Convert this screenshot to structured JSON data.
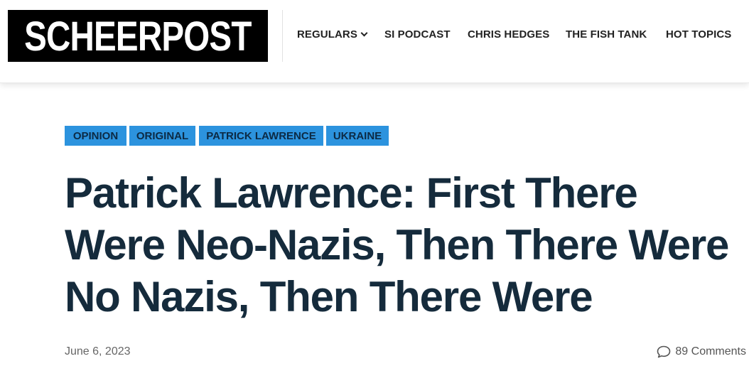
{
  "header": {
    "logo": "SCHEERPOST",
    "nav": [
      {
        "label": "REGULARS"
      },
      {
        "label": "SI PODCAST"
      },
      {
        "label": "CHRIS HEDGES"
      },
      {
        "label": "THE FISH TANK"
      },
      {
        "label": "HOT TOPICS"
      }
    ]
  },
  "article": {
    "tags": [
      "OPINION",
      "ORIGINAL",
      "PATRICK LAWRENCE",
      "UKRAINE"
    ],
    "title": "Patrick Lawrence: First There Were Neo-Nazis, Then There Were No Nazis, Then There Were",
    "date": "June 6, 2023",
    "comments": "89 Comments"
  },
  "colors": {
    "tag_bg": "#2c93de",
    "title": "#152b3c",
    "logo_bg": "#000000"
  },
  "icons": {
    "nav_dropdown": "chevron-down-icon",
    "comments": "comment-bubble-icon"
  }
}
